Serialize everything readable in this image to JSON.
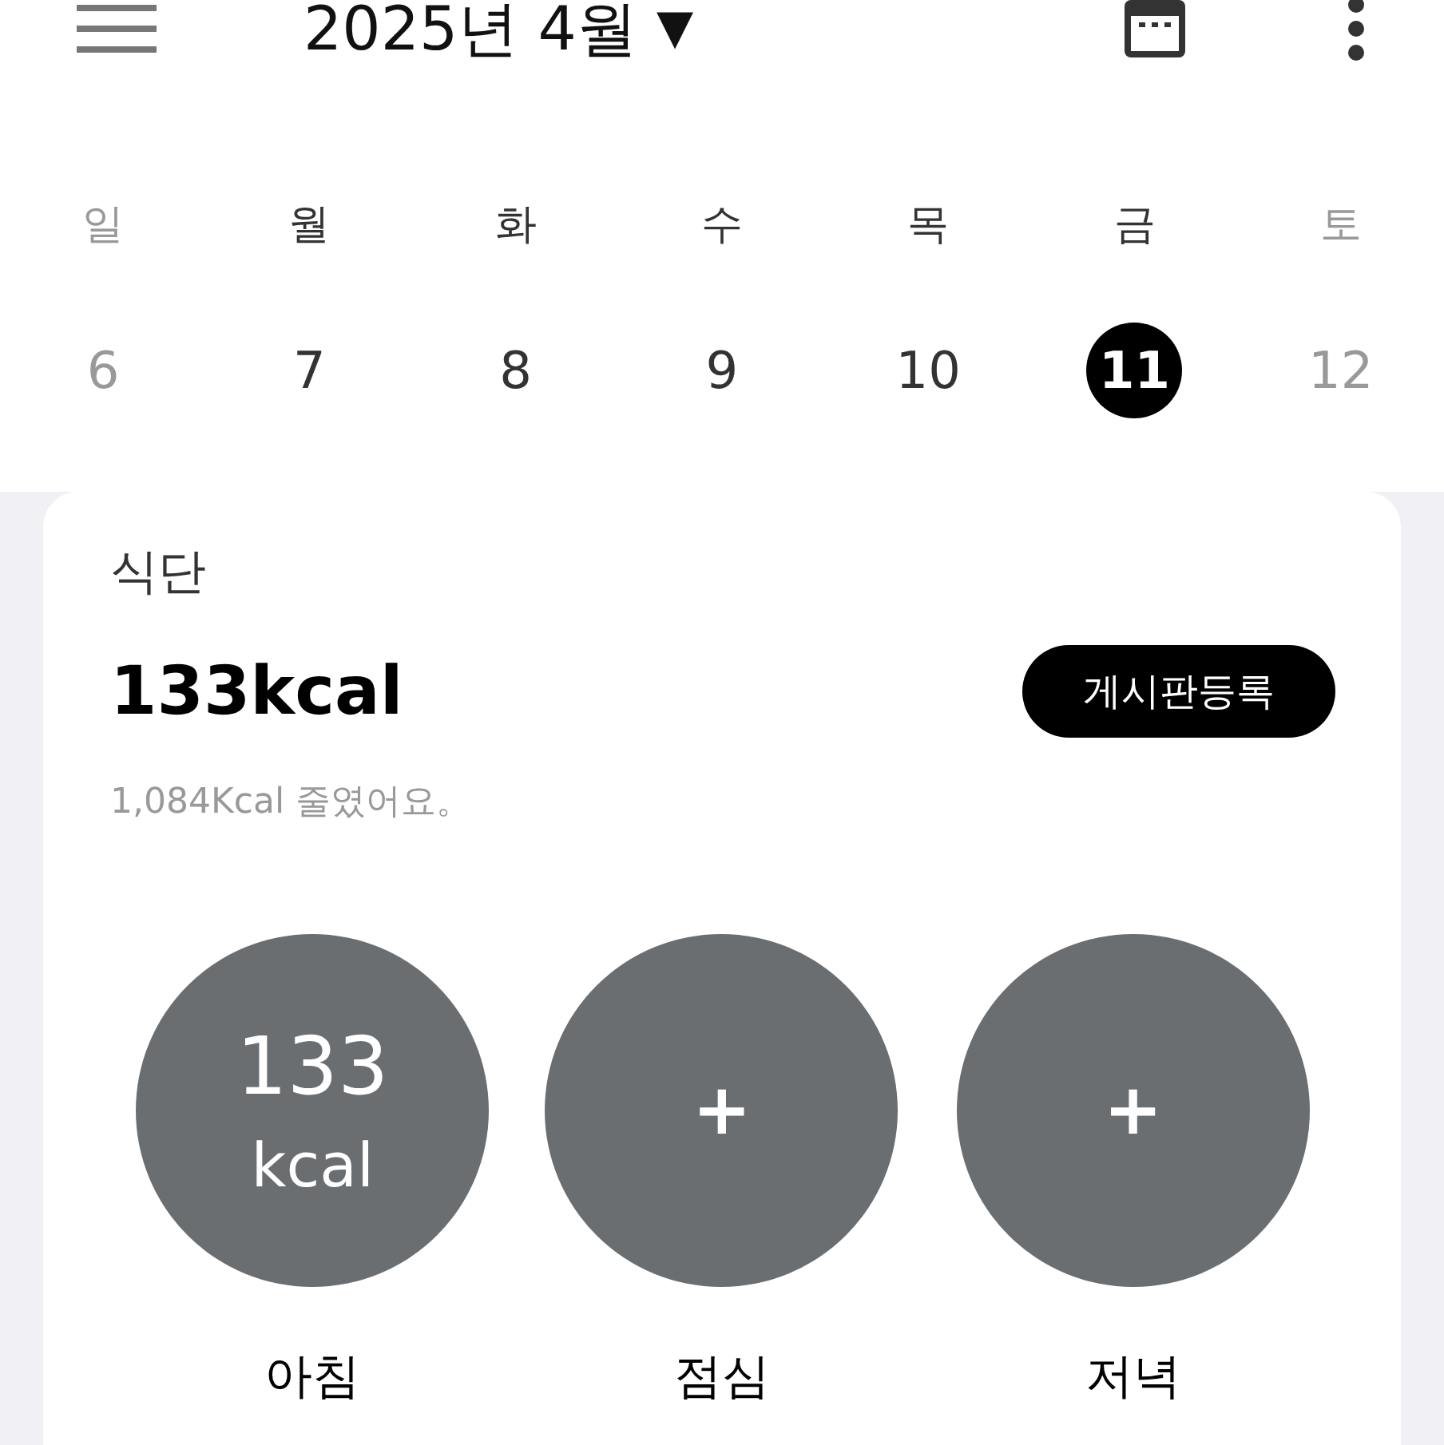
{
  "header": {
    "title": "2025년 4월",
    "dropdown_arrow": "▼"
  },
  "weekdays": [
    {
      "label": "일",
      "muted": true
    },
    {
      "label": "월",
      "muted": false
    },
    {
      "label": "화",
      "muted": false
    },
    {
      "label": "수",
      "muted": false
    },
    {
      "label": "목",
      "muted": false
    },
    {
      "label": "금",
      "muted": false
    },
    {
      "label": "토",
      "muted": true
    }
  ],
  "dates": [
    {
      "label": "6",
      "muted": true,
      "selected": false
    },
    {
      "label": "7",
      "muted": false,
      "selected": false
    },
    {
      "label": "8",
      "muted": false,
      "selected": false
    },
    {
      "label": "9",
      "muted": false,
      "selected": false
    },
    {
      "label": "10",
      "muted": false,
      "selected": false
    },
    {
      "label": "11",
      "muted": false,
      "selected": true
    },
    {
      "label": "12",
      "muted": true,
      "selected": false
    }
  ],
  "diet_card": {
    "title": "식단",
    "total": "133kcal",
    "button": "게시판등록",
    "note": "1,084Kcal 줄였어요。",
    "meals": [
      {
        "kind": "filled",
        "value": "133",
        "unit": "kcal",
        "label": "아침"
      },
      {
        "kind": "empty",
        "symbol": "+",
        "label": "점심"
      },
      {
        "kind": "empty",
        "symbol": "+",
        "label": "저녁"
      }
    ]
  }
}
